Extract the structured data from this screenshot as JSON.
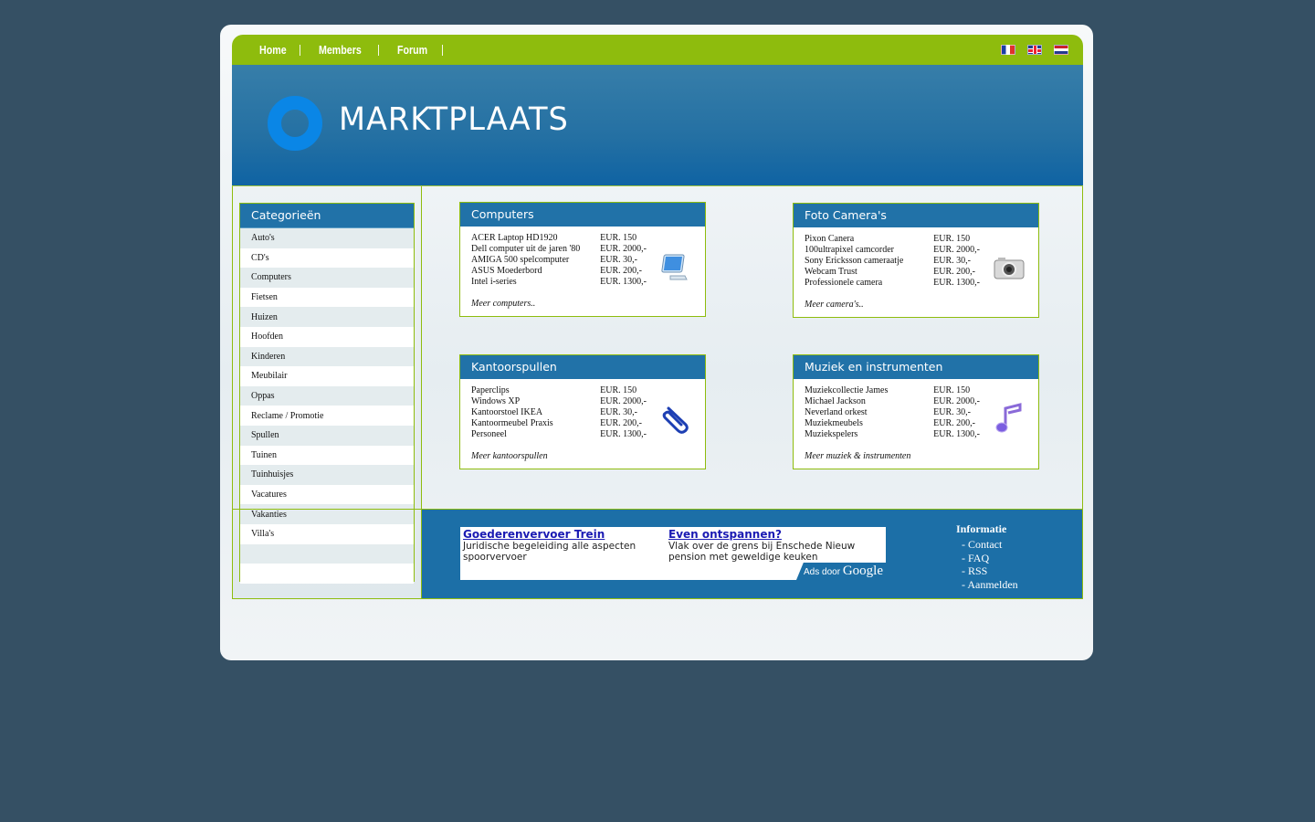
{
  "nav": {
    "links": [
      "Home",
      "Members",
      "Forum"
    ],
    "flags": [
      "flag-fr-icon",
      "flag-uk-icon",
      "flag-nl-icon"
    ]
  },
  "header": {
    "logo_text": "MARKTPLAATS"
  },
  "sidebar": {
    "title": "Categorieën",
    "items": [
      "Auto's",
      "CD's",
      "Computers",
      "Fietsen",
      "Huizen",
      "Hoofden",
      "Kinderen",
      "Meubilair",
      "Oppas",
      "Reclame / Promotie",
      "Spullen",
      "Tuinen",
      "Tuinhuisjes",
      "Vacatures",
      "Vakanties",
      "Villa's",
      "",
      ""
    ]
  },
  "boxes": [
    {
      "title": "Computers",
      "icon": "monitor-icon",
      "rows": [
        {
          "name": "ACER  Laptop HD1920",
          "price": "EUR. 150"
        },
        {
          "name": "Dell computer uit de jaren '80",
          "price": "EUR. 2000,-"
        },
        {
          "name": "AMIGA 500 spelcomputer",
          "price": "EUR. 30,-"
        },
        {
          "name": "ASUS Moederbord",
          "price": "EUR. 200,-"
        },
        {
          "name": "Intel i-series",
          "price": "EUR. 1300,-"
        }
      ],
      "more": "Meer computers.."
    },
    {
      "title": "Foto Camera's",
      "icon": "camera-icon",
      "rows": [
        {
          "name": "Pixon Canera",
          "price": "EUR. 150"
        },
        {
          "name": "100ultrapixel camcorder",
          "price": "EUR. 2000,-"
        },
        {
          "name": "Sony Ericksson cameraatje",
          "price": "EUR. 30,-"
        },
        {
          "name": "Webcam Trust",
          "price": "EUR. 200,-"
        },
        {
          "name": "Professionele camera",
          "price": "EUR. 1300,-"
        }
      ],
      "more": "Meer camera's.."
    },
    {
      "title": "Kantoorspullen",
      "icon": "paperclip-icon",
      "rows": [
        {
          "name": "Paperclips",
          "price": "EUR. 150"
        },
        {
          "name": "Windows XP",
          "price": "EUR. 2000,-"
        },
        {
          "name": "Kantoorstoel IKEA",
          "price": "EUR. 30,-"
        },
        {
          "name": "Kantoormeubel Praxis",
          "price": "EUR. 200,-"
        },
        {
          "name": "Personeel",
          "price": "EUR. 1300,-"
        }
      ],
      "more": "Meer kantoorspullen"
    },
    {
      "title": "Muziek en instrumenten",
      "icon": "music-note-icon",
      "rows": [
        {
          "name": "Muziekcollectie James",
          "price": "EUR. 150"
        },
        {
          "name": "Michael Jackson",
          "price": "EUR. 2000,-"
        },
        {
          "name": "Neverland orkest",
          "price": "EUR. 30,-"
        },
        {
          "name": "Muziekmeubels",
          "price": "EUR. 200,-"
        },
        {
          "name": "Muziekspelers",
          "price": "EUR. 1300,-"
        }
      ],
      "more": "Meer muziek & instrumenten"
    }
  ],
  "ads": {
    "items": [
      {
        "title": "Goederenvervoer Trein",
        "desc": "Juridische begeleiding alle aspecten spoorvervoer"
      },
      {
        "title": "Even ontspannen?",
        "desc": "Vlak over de grens bij Enschede Nieuw pension met geweldige keuken"
      }
    ],
    "ads_by": "Ads door",
    "google": "Google"
  },
  "info": {
    "title": "Informatie",
    "links": [
      "- Contact",
      "- FAQ",
      "- RSS",
      "- Aanmelden"
    ]
  },
  "colors": {
    "background": "#355064",
    "green": "#8ebc0d",
    "blue": "#2172a8",
    "logo_ring": "#0a86e6"
  }
}
